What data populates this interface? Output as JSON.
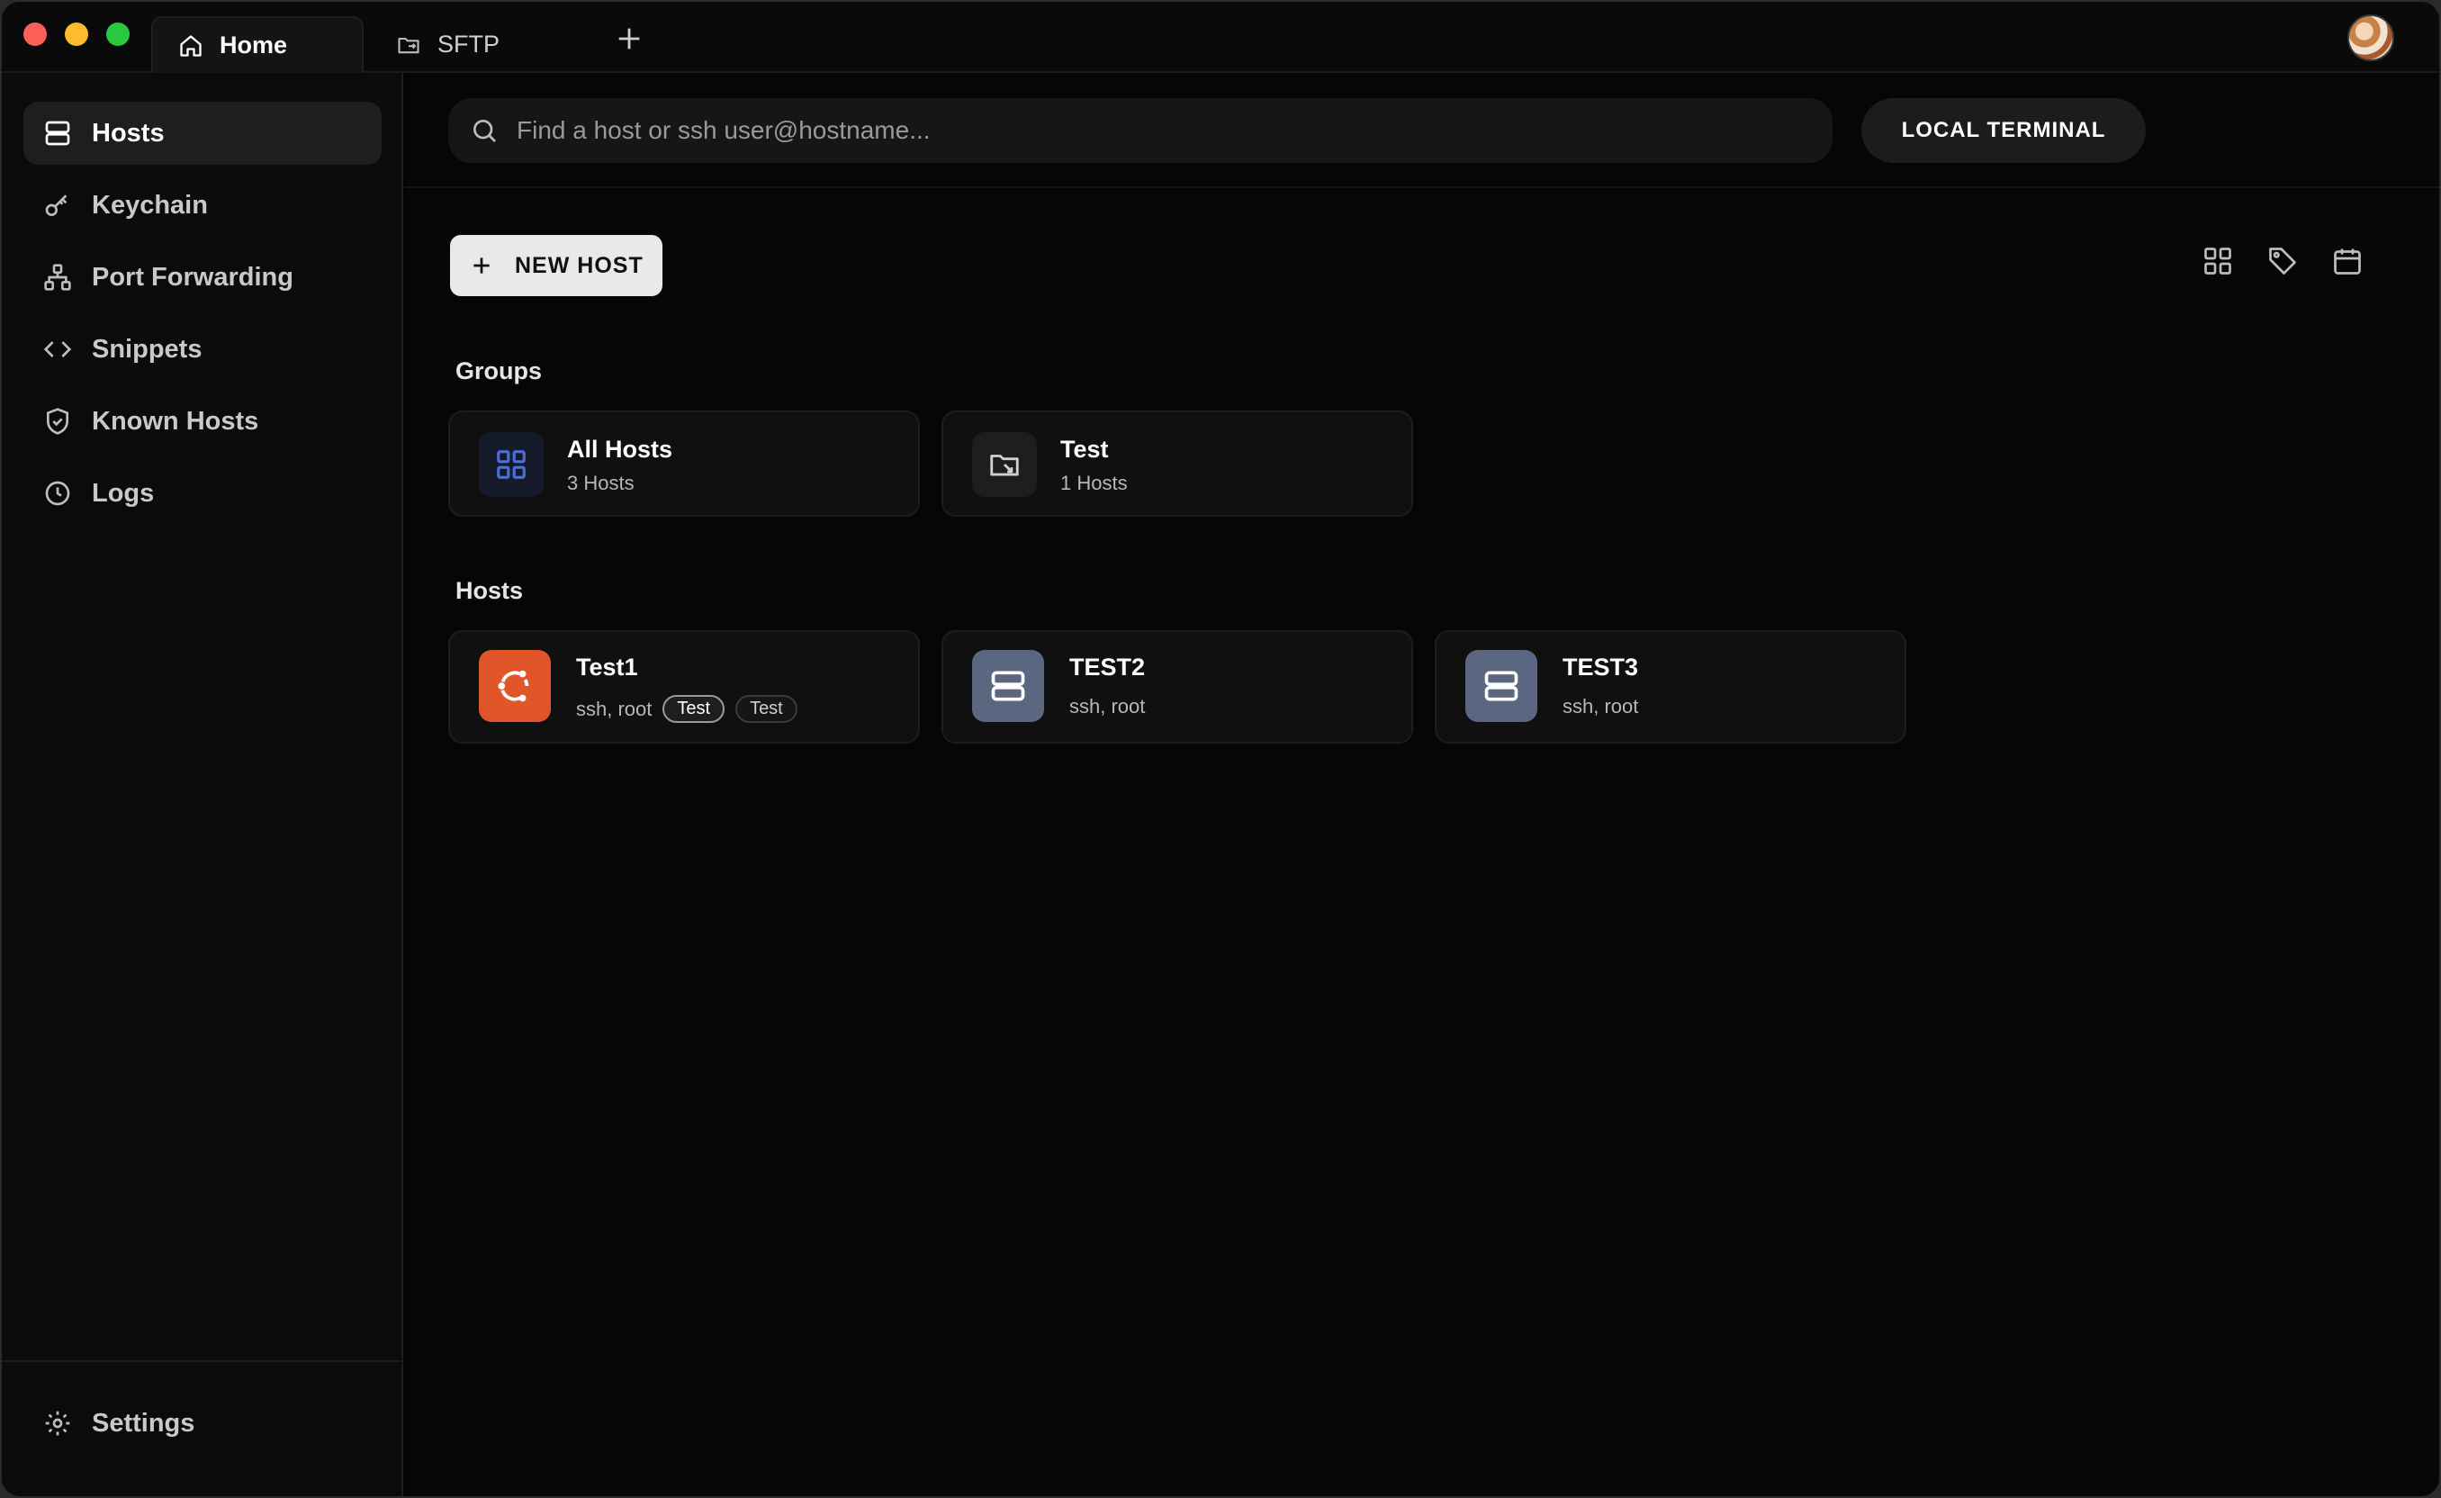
{
  "tabs": [
    {
      "label": "Home",
      "icon": "home-icon",
      "active": true
    },
    {
      "label": "SFTP",
      "icon": "folder-transfer-icon",
      "active": false
    }
  ],
  "sidebar": {
    "items": [
      {
        "label": "Hosts",
        "icon": "server-icon",
        "active": true
      },
      {
        "label": "Keychain",
        "icon": "key-icon"
      },
      {
        "label": "Port Forwarding",
        "icon": "network-icon"
      },
      {
        "label": "Snippets",
        "icon": "code-icon"
      },
      {
        "label": "Known Hosts",
        "icon": "shield-check-icon"
      },
      {
        "label": "Logs",
        "icon": "clock-icon"
      }
    ],
    "settings_label": "Settings"
  },
  "search": {
    "placeholder": "Find a host or ssh user@hostname..."
  },
  "local_terminal_label": "LOCAL TERMINAL",
  "new_host_label": "NEW HOST",
  "groups": {
    "title": "Groups",
    "items": [
      {
        "name": "All Hosts",
        "count": "3 Hosts",
        "icon": "grid-icon",
        "icon_color": "#4a6fd6"
      },
      {
        "name": "Test",
        "count": "1 Hosts",
        "icon": "folder-link-icon",
        "icon_color": "#d0d0d0"
      }
    ]
  },
  "hosts": {
    "title": "Hosts",
    "items": [
      {
        "name": "Test1",
        "sub": "ssh, root",
        "tags": [
          "Test",
          "Test"
        ],
        "icon": "ubuntu-icon",
        "icon_bg": "#e0562a"
      },
      {
        "name": "TEST2",
        "sub": "ssh, root",
        "tags": [],
        "icon": "server-icon",
        "icon_bg": "#5b6680"
      },
      {
        "name": "TEST3",
        "sub": "ssh, root",
        "tags": [],
        "icon": "server-icon",
        "icon_bg": "#5b6680"
      }
    ]
  },
  "colors": {
    "accent_orange": "#e0562a",
    "slate": "#5b6680",
    "bg": "#050505"
  }
}
